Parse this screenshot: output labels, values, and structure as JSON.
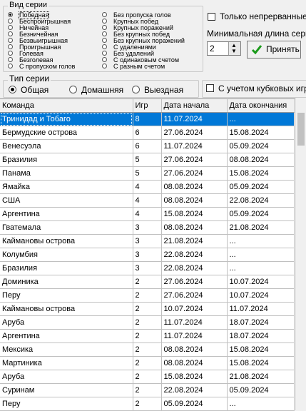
{
  "series_kind": {
    "legend": "Вид серии",
    "left_options": [
      "Победная",
      "Беспроигрышная",
      "Ничейная",
      "Безничейная",
      "Безвыигрышная",
      "Проигрышная",
      "Голевая",
      "Безголевая",
      "С пропуском голов"
    ],
    "right_options": [
      "Без пропуска голов",
      "Крупных побед",
      "Крупных поражений",
      "Без крупных побед",
      "Без крупных поражений",
      "С удалениями",
      "Без удалений",
      "С одинаковым счетом",
      "С разным счетом"
    ],
    "selected": "Победная"
  },
  "options": {
    "only_continuous_label": "Только непрерванные",
    "min_length_label": "Минимальная длина серии",
    "min_length_value": "2",
    "accept_label": "Принять",
    "with_cup_label": "С учетом кубковых игр"
  },
  "series_type": {
    "legend": "Тип серии",
    "options": [
      "Общая",
      "Домашняя",
      "Выездная"
    ],
    "selected": "Общая"
  },
  "table": {
    "columns": [
      "Команда",
      "Игр",
      "Дата начала",
      "Дата окончания"
    ],
    "rows": [
      [
        "Тринидад и Тобаго",
        "8",
        "11.07.2024",
        "..."
      ],
      [
        "Бермудские острова",
        "6",
        "27.06.2024",
        "15.08.2024"
      ],
      [
        "Венесуэла",
        "6",
        "11.07.2024",
        "05.09.2024"
      ],
      [
        "Бразилия",
        "5",
        "27.06.2024",
        "08.08.2024"
      ],
      [
        "Панама",
        "5",
        "27.06.2024",
        "15.08.2024"
      ],
      [
        "Ямайка",
        "4",
        "08.08.2024",
        "05.09.2024"
      ],
      [
        "США",
        "4",
        "08.08.2024",
        "22.08.2024"
      ],
      [
        "Аргентина",
        "4",
        "15.08.2024",
        "05.09.2024"
      ],
      [
        "Гватемала",
        "3",
        "08.08.2024",
        "21.08.2024"
      ],
      [
        "Каймановы острова",
        "3",
        "21.08.2024",
        "..."
      ],
      [
        "Колумбия",
        "3",
        "22.08.2024",
        "..."
      ],
      [
        "Бразилия",
        "3",
        "22.08.2024",
        "..."
      ],
      [
        "Доминика",
        "2",
        "27.06.2024",
        "10.07.2024"
      ],
      [
        "Перу",
        "2",
        "27.06.2024",
        "10.07.2024"
      ],
      [
        "Каймановы острова",
        "2",
        "10.07.2024",
        "11.07.2024"
      ],
      [
        "Аруба",
        "2",
        "11.07.2024",
        "18.07.2024"
      ],
      [
        "Аргентина",
        "2",
        "11.07.2024",
        "18.07.2024"
      ],
      [
        "Мексика",
        "2",
        "08.08.2024",
        "15.08.2024"
      ],
      [
        "Мартиника",
        "2",
        "08.08.2024",
        "15.08.2024"
      ],
      [
        "Аруба",
        "2",
        "15.08.2024",
        "21.08.2024"
      ],
      [
        "Суринам",
        "2",
        "22.08.2024",
        "05.09.2024"
      ],
      [
        "Перу",
        "2",
        "05.09.2024",
        "..."
      ]
    ]
  }
}
